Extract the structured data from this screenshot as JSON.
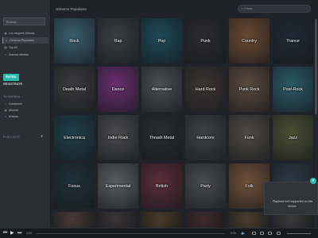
{
  "sidebar": {
    "search_placeholder": "Buscar...",
    "nav": [
      {
        "label": "Los mejores Álbums",
        "icon": "album-icon"
      },
      {
        "label": "Géneros Populares",
        "icon": "genre-icon"
      },
      {
        "label": "Top 50",
        "icon": "chart-icon"
      },
      {
        "label": "Nuevos artistas",
        "icon": "artist-icon"
      }
    ],
    "login_label": "ENTRA",
    "register_label": "REGISTRATE",
    "my_music_label": "TU MUSICA",
    "my_music": [
      {
        "label": "Canciones",
        "icon": "song-icon"
      },
      {
        "label": "Albums",
        "icon": "album-icon"
      },
      {
        "label": "Artistas",
        "icon": "artist-icon"
      }
    ],
    "playlists_label": "PLAYLISTS",
    "add_label": "+"
  },
  "header": {
    "title": "Géneros Populares",
    "filter_placeholder": "Filtrar"
  },
  "genres": [
    "Rock",
    "Rap",
    "Pop",
    "Punk",
    "Country",
    "Trance",
    "Death Metal",
    "Dance",
    "Alternative",
    "Hard Rock",
    "Punk Rock",
    "Post-Rock",
    "Electronica",
    "Indie Rock",
    "Thrash Metal",
    "Hardcore",
    "Funk",
    "Jazz",
    "Focus",
    "Experimental",
    "British",
    "Party",
    "Folk",
    "",
    "",
    "",
    "",
    "",
    "",
    ""
  ],
  "tile_colors": [
    "#3a5f6e",
    "#3a3d44",
    "#1d4a57",
    "#2b2b2e",
    "#6a4a32",
    "#1f2a33",
    "#3b3b3d",
    "#6a2d6e",
    "#4a4d52",
    "#3c3433",
    "#5a4a3c",
    "#2b5a66",
    "#1f3f4a",
    "#4a4a4c",
    "#2a2d30",
    "#3e4146",
    "#4d4a45",
    "#4b4e33",
    "#1e3138",
    "#5a5d60",
    "#5a2d3a",
    "#4a4a52",
    "#70503a",
    "#2c3a44",
    "#4a3a38",
    "#3a3536",
    "#4a3a2a",
    "#3f2a2e",
    "#4a3e2e",
    "#3a3a3a"
  ],
  "toast": {
    "message": "Playback isn't supported on this device.",
    "close_icon": "close-icon"
  },
  "player": {
    "current_time": "0:00",
    "total_time": "0:00",
    "progress": 0,
    "accent": "#2bbbad"
  }
}
